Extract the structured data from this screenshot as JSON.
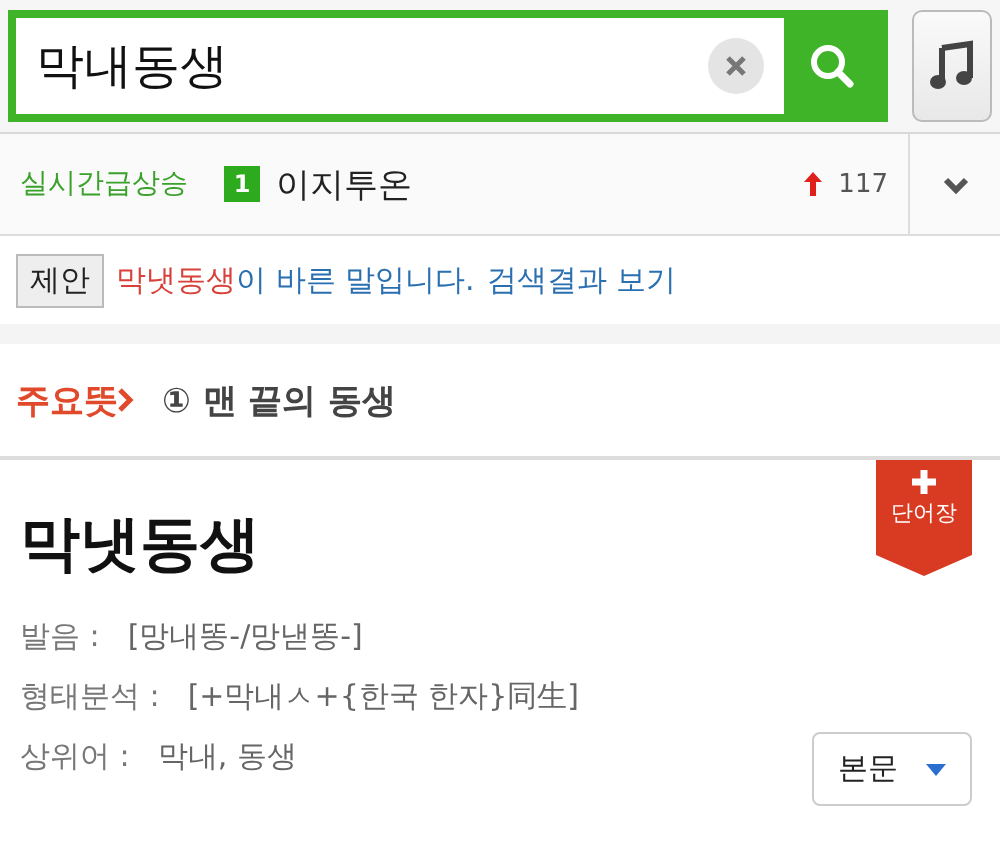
{
  "search": {
    "value": "막내동생"
  },
  "trending": {
    "label": "실시간급상승",
    "rank": "1",
    "term": "이지투온",
    "change": "117",
    "expanded": false
  },
  "suggestion": {
    "tag": "제안",
    "word": "막냇동생",
    "message": "이 바른 말입니다.",
    "link": "검색결과 보기"
  },
  "main_meaning": {
    "label": "주요뜻",
    "text": "① 맨 끝의 동생"
  },
  "entry": {
    "headword": "막냇동생",
    "badge": "단어장",
    "fields": [
      {
        "label": "발음 :",
        "value": "[망내똥-/망낻똥-]"
      },
      {
        "label": "형태분석 :",
        "value": "[+막내ㅅ+{한국 한자}同生]"
      },
      {
        "label": "상위어 :",
        "value": "막내, 동생"
      }
    ],
    "dropdown": "본문"
  }
}
